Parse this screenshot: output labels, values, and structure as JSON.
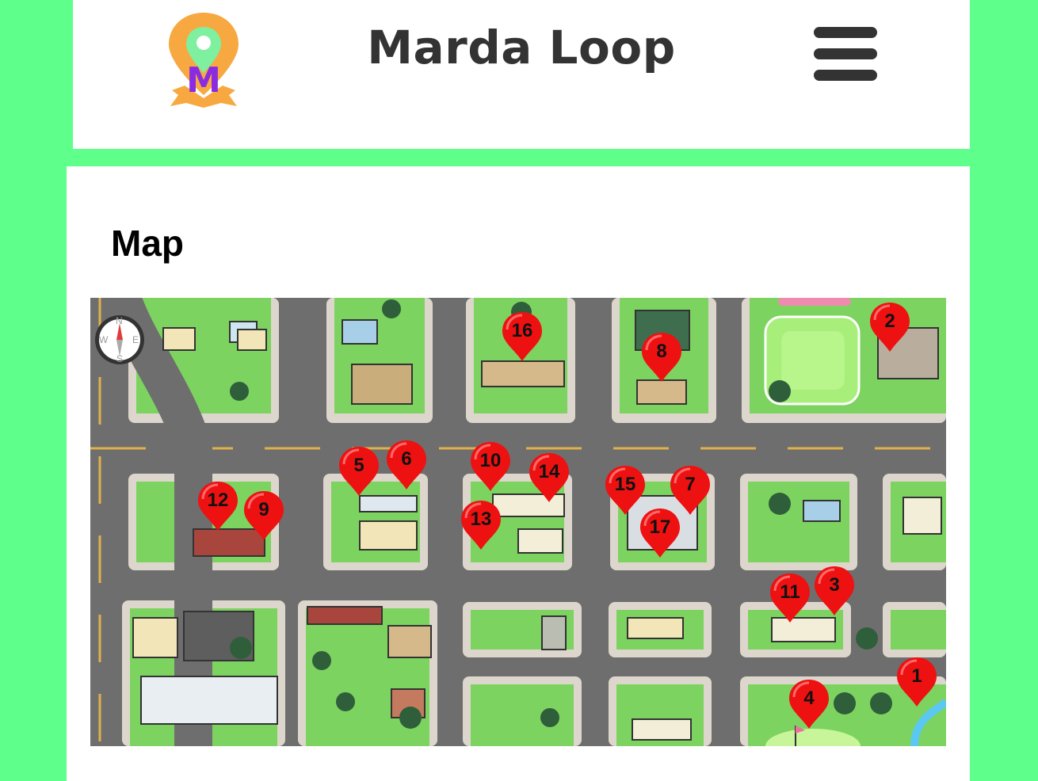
{
  "header": {
    "title": "Marda Loop",
    "logo_letter": "M",
    "logo_icon": "map-pin-ribbon",
    "menu_icon": "hamburger-menu"
  },
  "section": {
    "title": "Map"
  },
  "map": {
    "compass": {
      "n": "N",
      "s": "S",
      "e": "E",
      "w": "W"
    },
    "markers": [
      "1",
      "2",
      "3",
      "4",
      "5",
      "6",
      "7",
      "8",
      "9",
      "10",
      "11",
      "12",
      "13",
      "14",
      "15",
      "16",
      "17"
    ]
  },
  "colors": {
    "page_background": "#5eff8a",
    "header_background": "#ffffff",
    "title_text": "#333333",
    "marker_red": "#ee1111",
    "grass": "#7dd35f",
    "road": "#6e6e6e",
    "logo_orange": "#f7a840",
    "logo_green": "#7ef0a0",
    "logo_purple": "#8a2be2"
  }
}
